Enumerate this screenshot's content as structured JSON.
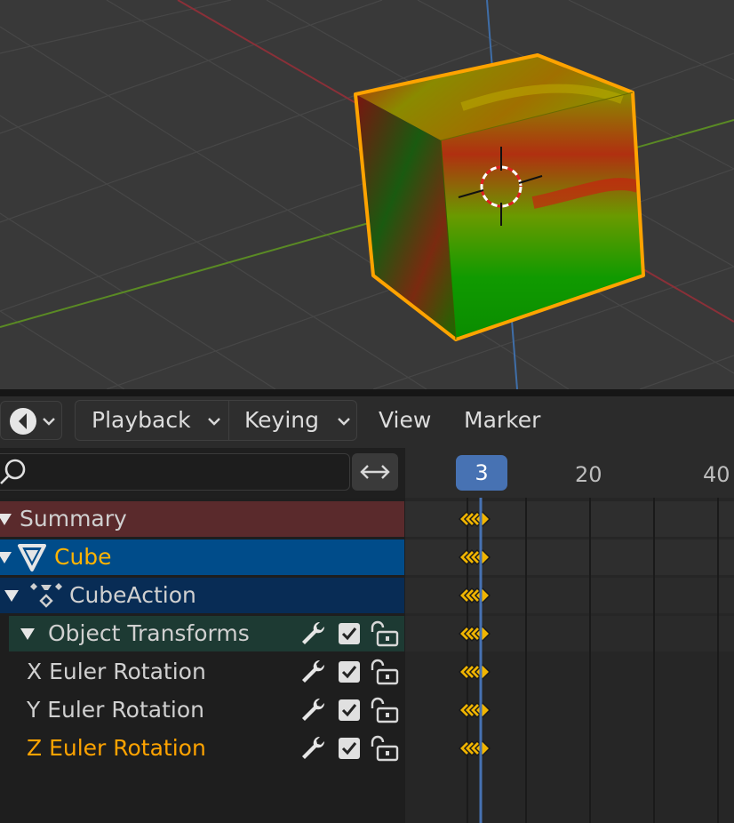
{
  "header": {
    "menus": [
      {
        "label": "Playback",
        "dropdown": true
      },
      {
        "label": "Keying",
        "dropdown": true
      },
      {
        "label": "View",
        "dropdown": false
      },
      {
        "label": "Marker",
        "dropdown": false
      }
    ],
    "editor_type_icon": "dope-sheet-icon"
  },
  "search": {
    "placeholder": "",
    "icon": "search-icon",
    "sync_icon": "left-right-arrows-icon"
  },
  "channels": [
    {
      "label": "Summary",
      "type": "summary",
      "color": "#d0d0d0"
    },
    {
      "label": "Cube",
      "type": "object",
      "color": "#ffb400",
      "icon": "mesh-object-icon"
    },
    {
      "label": "CubeAction",
      "type": "action",
      "color": "#d0d0d0",
      "icon": "action-icon"
    },
    {
      "label": "Object Transforms",
      "type": "group",
      "color": "#d0d0d0"
    },
    {
      "label": "X Euler Rotation",
      "type": "fcurve",
      "color": "#d0d0d0"
    },
    {
      "label": "Y Euler Rotation",
      "type": "fcurve",
      "color": "#d0d0d0"
    },
    {
      "label": "Z Euler Rotation",
      "type": "fcurve",
      "color": "#ffa300"
    }
  ],
  "timeline": {
    "current_frame": "3",
    "tick_labels": [
      "20",
      "40"
    ]
  },
  "colors": {
    "summary_bg": "#5a2a2c",
    "object_bg": "#004c8a",
    "action_bg": "#082c55",
    "group_bg": "#1d3a33",
    "selection_orange": "#ffa300",
    "keyframe": "#f0b400",
    "playhead": "#4772b3"
  }
}
